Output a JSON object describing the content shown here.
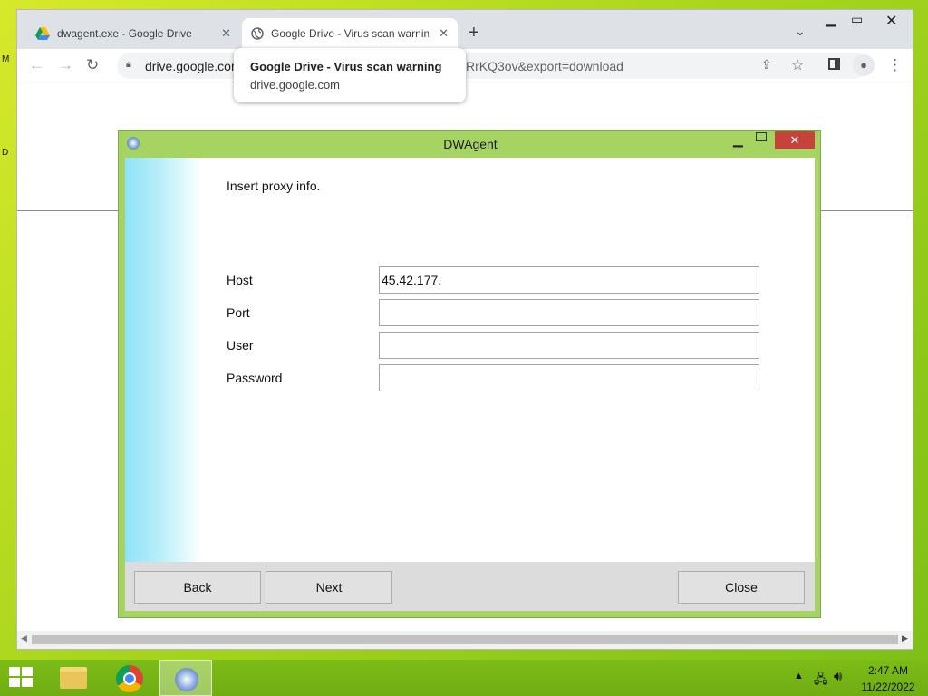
{
  "browser": {
    "tabs": [
      {
        "title": "dwagent.exe - Google Drive",
        "close": "✕"
      },
      {
        "title": "Google Drive - Virus scan warning",
        "close": "✕"
      }
    ],
    "new_tab": "+",
    "url_left": "drive.google.com",
    "url_right": "RrKQ3ov&export=download",
    "hover_card": {
      "title": "Google Drive - Virus scan warning",
      "domain": "drive.google.com"
    }
  },
  "dialog": {
    "title": "DWAgent",
    "prompt": "Insert proxy info.",
    "fields": [
      {
        "label": "Host",
        "value": "45.42.177."
      },
      {
        "label": "Port",
        "value": ""
      },
      {
        "label": "User",
        "value": ""
      },
      {
        "label": "Password",
        "value": ""
      }
    ],
    "buttons": {
      "back": "Back",
      "next": "Next",
      "close": "Close"
    }
  },
  "taskbar": {
    "time": "2:47 AM",
    "date": "11/22/2022"
  },
  "icons": {
    "google-drive": "google-drive-icon",
    "globe": "globe-icon",
    "lock": "lock-icon",
    "windows": "windows-logo-icon"
  },
  "colors": {
    "desktop": "#a9d61d",
    "dialog_frame": "#a6d463",
    "dialog_close": "#c7423b",
    "banner": "#8fe3f7"
  }
}
